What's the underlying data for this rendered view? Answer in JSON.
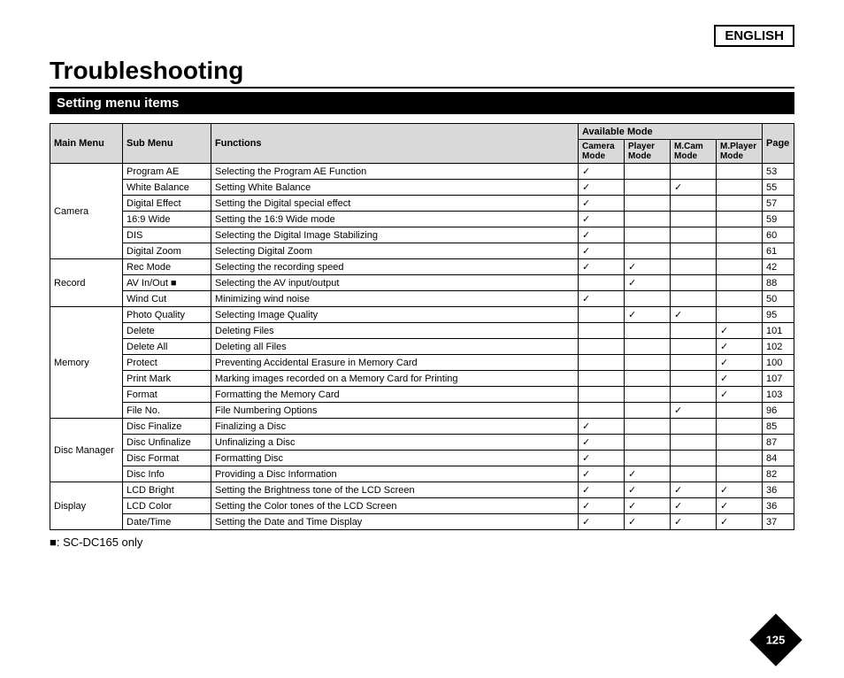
{
  "language": "ENGLISH",
  "title": "Troubleshooting",
  "section": "Setting menu items",
  "headers": {
    "main": "Main Menu",
    "sub": "Sub Menu",
    "func": "Functions",
    "avail": "Available Mode",
    "camera": "Camera Mode",
    "player": "Player Mode",
    "mcam": "M.Cam Mode",
    "mplayer": "M.Player Mode",
    "page": "Page"
  },
  "groups": [
    {
      "main": "Camera",
      "rows": [
        {
          "sub": "Program AE",
          "func": "Selecting the Program AE Function",
          "camera": "✓",
          "player": "",
          "mcam": "",
          "mplayer": "",
          "page": "53"
        },
        {
          "sub": "White Balance",
          "func": "Setting White Balance",
          "camera": "✓",
          "player": "",
          "mcam": "✓",
          "mplayer": "",
          "page": "55"
        },
        {
          "sub": "Digital Effect",
          "func": "Setting the Digital special effect",
          "camera": "✓",
          "player": "",
          "mcam": "",
          "mplayer": "",
          "page": "57"
        },
        {
          "sub": "16:9 Wide",
          "func": "Setting the 16:9 Wide mode",
          "camera": "✓",
          "player": "",
          "mcam": "",
          "mplayer": "",
          "page": "59"
        },
        {
          "sub": "DIS",
          "func": "Selecting the Digital Image Stabilizing",
          "camera": "✓",
          "player": "",
          "mcam": "",
          "mplayer": "",
          "page": "60"
        },
        {
          "sub": "Digital Zoom",
          "func": "Selecting Digital Zoom",
          "camera": "✓",
          "player": "",
          "mcam": "",
          "mplayer": "",
          "page": "61"
        }
      ]
    },
    {
      "main": "Record",
      "rows": [
        {
          "sub": "Rec Mode",
          "func": "Selecting the recording speed",
          "camera": "✓",
          "player": "✓",
          "mcam": "",
          "mplayer": "",
          "page": "42"
        },
        {
          "sub": "AV In/Out ■",
          "func": "Selecting the AV input/output",
          "camera": "",
          "player": "✓",
          "mcam": "",
          "mplayer": "",
          "page": "88"
        },
        {
          "sub": "Wind Cut",
          "func": "Minimizing wind noise",
          "camera": "✓",
          "player": "",
          "mcam": "",
          "mplayer": "",
          "page": "50"
        }
      ]
    },
    {
      "main": "Memory",
      "rows": [
        {
          "sub": "Photo Quality",
          "func": "Selecting Image Quality",
          "camera": "",
          "player": "✓",
          "mcam": "✓",
          "mplayer": "",
          "page": "95"
        },
        {
          "sub": "Delete",
          "func": "Deleting Files",
          "camera": "",
          "player": "",
          "mcam": "",
          "mplayer": "✓",
          "page": "101"
        },
        {
          "sub": "Delete All",
          "func": "Deleting all Files",
          "camera": "",
          "player": "",
          "mcam": "",
          "mplayer": "✓",
          "page": "102"
        },
        {
          "sub": "Protect",
          "func": "Preventing Accidental Erasure in Memory Card",
          "camera": "",
          "player": "",
          "mcam": "",
          "mplayer": "✓",
          "page": "100"
        },
        {
          "sub": "Print Mark",
          "func": "Marking images recorded on a Memory Card for Printing",
          "camera": "",
          "player": "",
          "mcam": "",
          "mplayer": "✓",
          "page": "107"
        },
        {
          "sub": "Format",
          "func": "Formatting the Memory Card",
          "camera": "",
          "player": "",
          "mcam": "",
          "mplayer": "✓",
          "page": "103"
        },
        {
          "sub": "File No.",
          "func": "File Numbering Options",
          "camera": "",
          "player": "",
          "mcam": "✓",
          "mplayer": "",
          "page": "96"
        }
      ]
    },
    {
      "main": "Disc Manager",
      "rows": [
        {
          "sub": "Disc Finalize",
          "func": "Finalizing a Disc",
          "camera": "✓",
          "player": "",
          "mcam": "",
          "mplayer": "",
          "page": "85"
        },
        {
          "sub": "Disc Unfinalize",
          "func": "Unfinalizing a Disc",
          "camera": "✓",
          "player": "",
          "mcam": "",
          "mplayer": "",
          "page": "87"
        },
        {
          "sub": "Disc Format",
          "func": "Formatting Disc",
          "camera": "✓",
          "player": "",
          "mcam": "",
          "mplayer": "",
          "page": "84"
        },
        {
          "sub": "Disc Info",
          "func": "Providing a Disc Information",
          "camera": "✓",
          "player": "✓",
          "mcam": "",
          "mplayer": "",
          "page": "82"
        }
      ]
    },
    {
      "main": "Display",
      "rows": [
        {
          "sub": "LCD Bright",
          "func": "Setting the Brightness tone of the LCD Screen",
          "camera": "✓",
          "player": "✓",
          "mcam": "✓",
          "mplayer": "✓",
          "page": "36"
        },
        {
          "sub": "LCD Color",
          "func": "Setting the Color tones of the LCD Screen",
          "camera": "✓",
          "player": "✓",
          "mcam": "✓",
          "mplayer": "✓",
          "page": "36"
        },
        {
          "sub": "Date/Time",
          "func": "Setting the Date and Time Display",
          "camera": "✓",
          "player": "✓",
          "mcam": "✓",
          "mplayer": "✓",
          "page": "37"
        }
      ]
    }
  ],
  "note": "■: SC-DC165 only",
  "pageNumber": "125"
}
